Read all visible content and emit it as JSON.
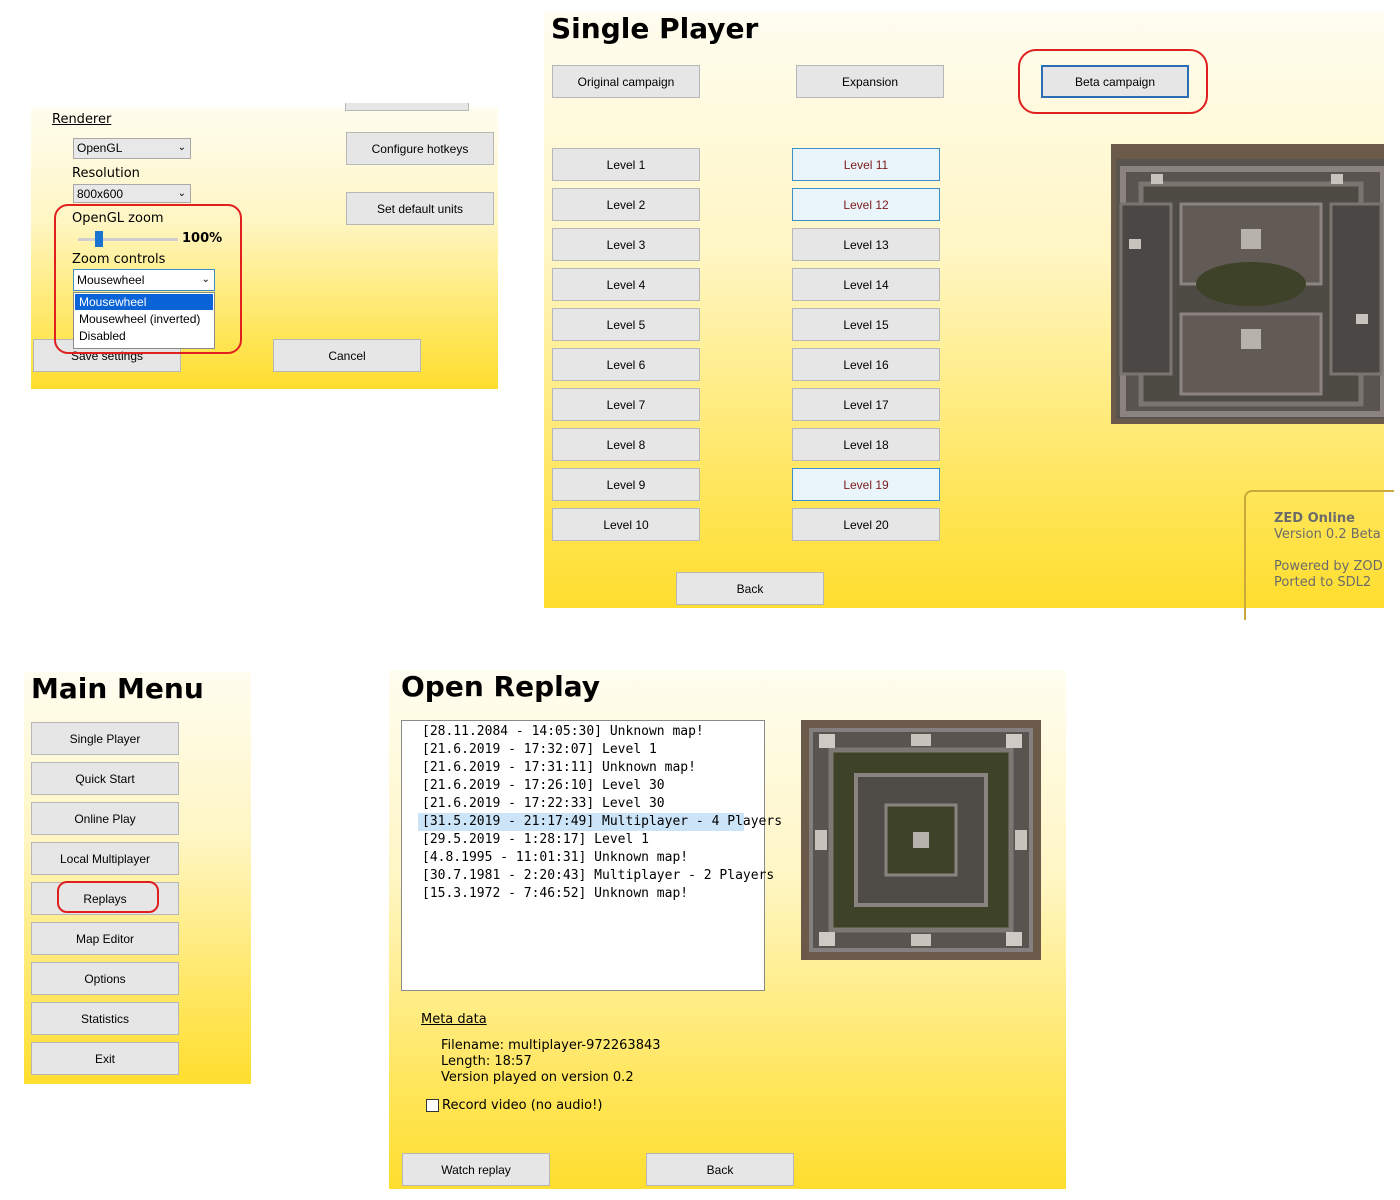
{
  "options": {
    "renderer_label": "Renderer",
    "renderer_value": "OpenGL",
    "resolution_label": "Resolution",
    "resolution_value": "800x600",
    "zoom_label": "OpenGL zoom",
    "zoom_value": "100%",
    "zoom_fraction": 0.1,
    "zoom_controls_label": "Zoom controls",
    "zoom_controls_value": "Mousewheel",
    "zoom_controls_options": [
      "Mousewheel",
      "Mousewheel (inverted)",
      "Disabled"
    ],
    "configure_hotkeys": "Configure hotkeys",
    "set_default_units": "Set default units",
    "save_settings": "Save settings",
    "cancel": "Cancel"
  },
  "single_player": {
    "title": "Single Player",
    "tabs": [
      "Original campaign",
      "Expansion",
      "Beta campaign"
    ],
    "levels_left": [
      "Level 1",
      "Level 2",
      "Level 3",
      "Level 4",
      "Level 5",
      "Level 6",
      "Level 7",
      "Level 8",
      "Level 9",
      "Level 10"
    ],
    "levels_right": [
      "Level 11",
      "Level 12",
      "Level 13",
      "Level 14",
      "Level 15",
      "Level 16",
      "Level 17",
      "Level 18",
      "Level 19",
      "Level 20"
    ],
    "back": "Back",
    "info_name": "ZED Online",
    "info_version": "Version 0.2 Beta",
    "info_powered": "Powered by ZOD",
    "info_ported": "Ported to SDL2"
  },
  "main_menu": {
    "title": "Main Menu",
    "items": [
      "Single Player",
      "Quick Start",
      "Online Play",
      "Local Multiplayer",
      "Replays",
      "Map Editor",
      "Options",
      "Statistics",
      "Exit"
    ]
  },
  "open_replay": {
    "title": "Open Replay",
    "replays": [
      "[28.11.2084 - 14:05:30] Unknown map!",
      "[21.6.2019 - 17:32:07] Level 1",
      "[21.6.2019 - 17:31:11] Unknown map!",
      "[21.6.2019 - 17:26:10] Level 30",
      "[21.6.2019 - 17:22:33] Level 30",
      "[31.5.2019 - 21:17:49] Multiplayer - 4 Players",
      "[29.5.2019 - 1:28:17] Level 1",
      "[4.8.1995 - 11:01:31] Unknown map!",
      "[30.7.1981 - 2:20:43] Multiplayer - 2 Players",
      "[15.3.1972 - 7:46:52] Unknown map!"
    ],
    "meta_label": "Meta data",
    "meta_filename": "Filename: multiplayer-972263843",
    "meta_length": "Length: 18:57",
    "meta_version": "Version played on version 0.2",
    "record_video": "Record video (no audio!)",
    "watch_replay": "Watch replay",
    "back": "Back"
  }
}
